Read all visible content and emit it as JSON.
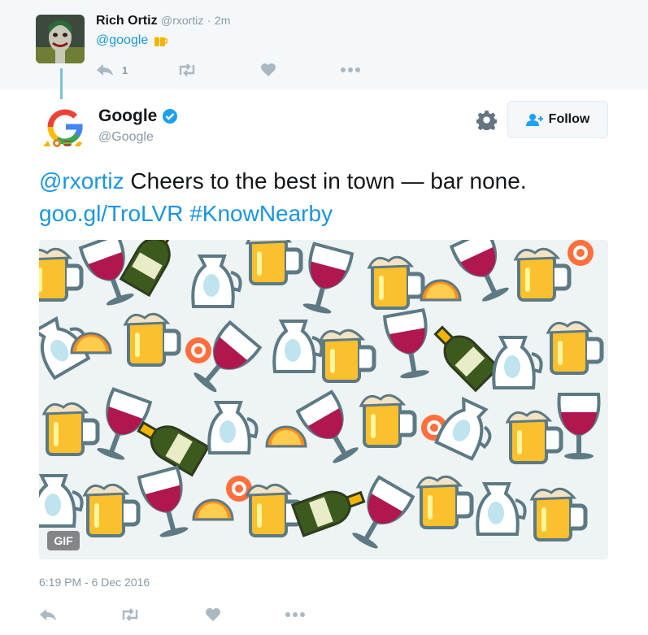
{
  "reply": {
    "name": "Rich Ortiz",
    "handle": "@rxortiz",
    "separator": "·",
    "time": "2m",
    "text": "@google",
    "reply_count": "1"
  },
  "tweet": {
    "name": "Google",
    "handle": "@Google",
    "follow_label": "Follow",
    "text_mention": "@rxortiz",
    "text_body": " Cheers to the best in town — bar none.",
    "text_link": "goo.gl/TroLVR",
    "text_hashtag": "#KnowNearby",
    "gif_label": "GIF",
    "timestamp": "6:19 PM - 6 Dec 2016"
  },
  "colors": {
    "link": "#1b95e0",
    "muted": "#8899a6",
    "verified": "#1da1f2",
    "thread_line": "#78c4d4"
  },
  "icons": {
    "reply": "reply-icon",
    "retweet": "retweet-icon",
    "like": "heart-icon",
    "more": "more-icon",
    "settings": "gear-icon",
    "follow": "add-user-icon",
    "verified": "verified-badge-icon"
  }
}
